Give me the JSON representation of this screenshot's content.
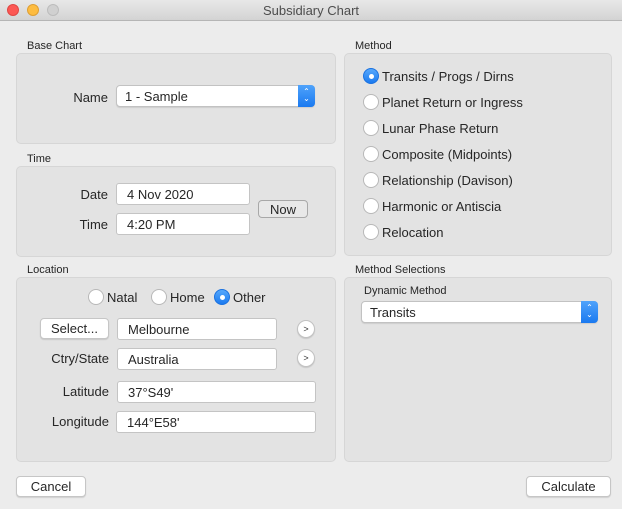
{
  "window": {
    "title": "Subsidiary Chart"
  },
  "base_chart": {
    "section_label": "Base Chart",
    "name_label": "Name",
    "name_value": "1 - Sample"
  },
  "time": {
    "section_label": "Time",
    "date_label": "Date",
    "date_value": "4 Nov 2020",
    "time_label": "Time",
    "time_value": "4:20 PM",
    "now_button": "Now"
  },
  "location": {
    "section_label": "Location",
    "options": [
      {
        "label": "Natal",
        "selected": false
      },
      {
        "label": "Home",
        "selected": false
      },
      {
        "label": "Other",
        "selected": true
      }
    ],
    "select_button": "Select...",
    "place_value": "Melbourne",
    "country_label": "Ctry/State",
    "country_value": "Australia",
    "latitude_label": "Latitude",
    "latitude_value": "37°S49'",
    "longitude_label": "Longitude",
    "longitude_value": "144°E58'",
    "arrow_glyph": ">"
  },
  "method": {
    "section_label": "Method",
    "options": [
      {
        "label": "Transits / Progs / Dirns",
        "selected": true
      },
      {
        "label": "Planet Return or Ingress",
        "selected": false
      },
      {
        "label": "Lunar Phase Return",
        "selected": false
      },
      {
        "label": "Composite (Midpoints)",
        "selected": false
      },
      {
        "label": "Relationship (Davison)",
        "selected": false
      },
      {
        "label": "Harmonic or Antiscia",
        "selected": false
      },
      {
        "label": "Relocation",
        "selected": false
      }
    ]
  },
  "method_selections": {
    "section_label": "Method Selections",
    "dynamic_label": "Dynamic Method",
    "dynamic_value": "Transits"
  },
  "footer": {
    "cancel": "Cancel",
    "calculate": "Calculate"
  },
  "colors": {
    "accent": "#1b7af0",
    "close": "#fc5753",
    "minimize": "#fdbc40"
  }
}
